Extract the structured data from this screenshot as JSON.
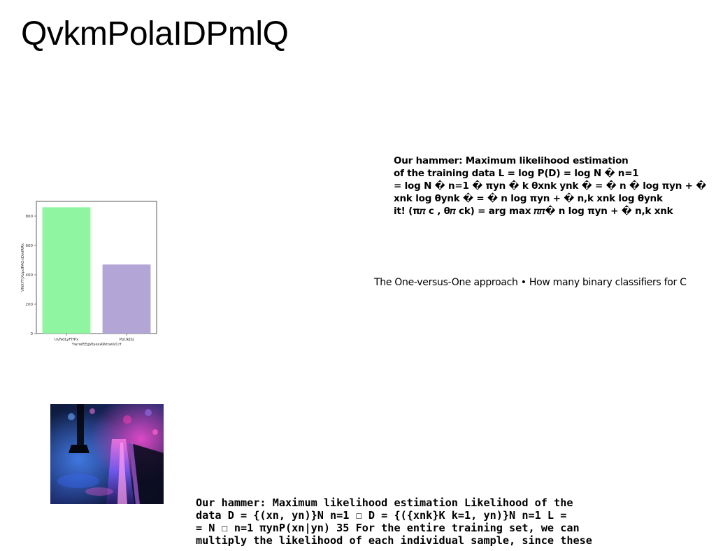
{
  "page": {
    "title": "QvkmPolaIDPmlQ"
  },
  "text_block_1": {
    "lines": [
      "Our hammer: Maximum likelihood estimation",
      "of the training data L = log P(D) = log N � n=1",
      "= log N � n=1 � πyn � k θxnk ynk � = � n � log πyn + �",
      "xnk log θynk � = � n log πyn + � n,k xnk log θynk",
      "it! (π𝜋 c , θ𝜋 ck) = arg max 𝜋𝜋� n log πyn + � n,k xnk"
    ]
  },
  "ovo_line": "The One-versus-One approach • How many binary classifiers for C",
  "text_block_2": {
    "lines": [
      "Our hammer: Maximum likelihood estimation Likelihood of the",
      "data D = {(xn, yn)}N n=1 ☐ D = {({xnk}K k=1, yn)}N n=1 L =",
      "= N ☐ n=1 πynP(xn|yn) 35 For the entire training set, we can",
      "multiply the likelihood of each individual sample, since these"
    ]
  },
  "chart_data": {
    "type": "bar",
    "categories": [
      "UvNdLyFHPx",
      "PpUkJSJ"
    ],
    "values": [
      860,
      470
    ],
    "colors": [
      "#90f5a0",
      "#b3a6d6"
    ],
    "xlabel": "YwrwEEgWyexAWrowVCrf",
    "ylabel": "VNXYTjXzpdPAGnDwIRRk",
    "yticks": [
      0,
      200,
      400,
      600,
      800
    ],
    "ylim": [
      0,
      900
    ],
    "grid": false
  },
  "photo": {
    "icon": "night-street-reflection-photo"
  }
}
